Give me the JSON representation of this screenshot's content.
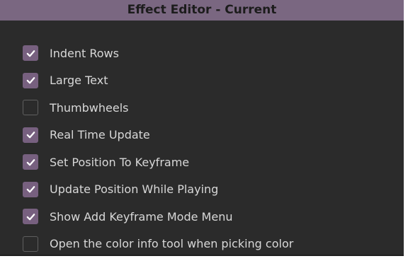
{
  "window": {
    "title": "Effect Editor - Current"
  },
  "colors": {
    "titlebar": "#7a6781",
    "checked": "#77607f",
    "background": "#2b2b2b"
  },
  "options": [
    {
      "label": "Indent Rows",
      "checked": true,
      "icon": "check-icon"
    },
    {
      "label": "Large Text",
      "checked": true,
      "icon": "check-icon"
    },
    {
      "label": "Thumbwheels",
      "checked": false,
      "icon": ""
    },
    {
      "label": "Real Time Update",
      "checked": true,
      "icon": "check-icon"
    },
    {
      "label": "Set Position To Keyframe",
      "checked": true,
      "icon": "check-icon"
    },
    {
      "label": "Update Position While Playing",
      "checked": true,
      "icon": "check-icon"
    },
    {
      "label": "Show Add Keyframe Mode Menu",
      "checked": true,
      "icon": "check-icon"
    },
    {
      "label": "Open the color info tool when picking color",
      "checked": false,
      "icon": ""
    }
  ]
}
